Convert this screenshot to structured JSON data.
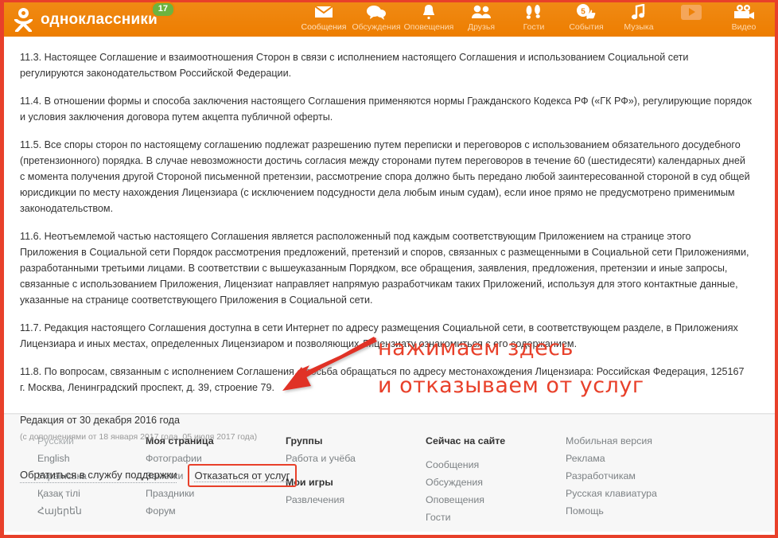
{
  "header": {
    "logo_text": "одноклассники",
    "logo_badge": "17",
    "nav": [
      {
        "label": "Сообщения",
        "icon": "envelope-icon"
      },
      {
        "label": "Обсуждения",
        "icon": "chat-bubbles-icon"
      },
      {
        "label": "Оповещения",
        "icon": "bell-icon"
      },
      {
        "label": "Друзья",
        "icon": "people-icon"
      },
      {
        "label": "Гости",
        "icon": "footprints-icon"
      },
      {
        "label": "События",
        "icon": "thumbs-up-icon",
        "badge": "5"
      },
      {
        "label": "Музыка",
        "icon": "music-note-icon"
      },
      {
        "label": "Видео",
        "icon": "video-camera-icon"
      }
    ]
  },
  "agreement": {
    "paragraphs": [
      "11.3. Настоящее Соглашение и взаимоотношения Сторон в связи с исполнением настоящего Соглашения и использованием Социальной сети регулируются законодательством Российской Федерации.",
      "11.4. В отношении формы и способа заключения настоящего Соглашения применяются нормы Гражданского Кодекса РФ («ГК РФ»), регулирующие порядок и условия заключения договора путем акцепта публичной оферты.",
      "11.5. Все споры сторон по настоящему соглашению подлежат разрешению путем переписки и переговоров с использованием обязательного досудебного (претензионного) порядка. В случае невозможности достичь согласия между сторонами путем переговоров в течение 60 (шестидесяти) календарных дней с момента получения другой Стороной письменной претензии, рассмотрение спора должно быть передано любой заинтересованной стороной в суд общей юрисдикции по месту нахождения Лицензиара (с исключением подсудности дела любым иным судам), если иное прямо не предусмотрено применимым законодательством.",
      "11.6. Неотъемлемой частью настоящего Соглашения является расположенный под каждым соответствующим Приложением на странице этого Приложения в Социальной сети Порядок рассмотрения предложений, претензий и споров, связанных с размещенными в Социальной сети Приложениями, разработанными третьими лицами. В соответствии с вышеуказанным Порядком, все обращения, заявления, предложения, претензии и иные запросы, связанные с использованием Приложения, Лицензиат направляет напрямую разработчикам таких Приложений, используя для этого контактные данные, указанные на странице соответствующего Приложения в Социальной сети.",
      "11.7. Редакция настоящего Соглашения доступна в сети Интернет по адресу размещения Социальной сети, в соответствующем разделе, в Приложениях Лицензиара и иных местах, определенных Лицензиаром и позволяющих Лицензиату ознакомиться с его содержанием.",
      "11.8. По вопросам, связанным с исполнением Соглашения, просьба обращаться по адресу местонахождения Лицензиара: Российская Федерация, 125167 г. Москва, Ленинградский проспект, д. 39, строение 79."
    ],
    "revision_title": "Редакция от 30 декабря 2016 года",
    "revision_sub": "(с дополнениями от 18 января 2017 года, 05 июля 2017 года)",
    "support_link": "Обратиться в службу поддержки",
    "cancel_link": "Отказаться от услуг"
  },
  "annotation": {
    "line1": "нажимаем здесь",
    "line2": "и отказываем от услуг",
    "color": "#e8402a"
  },
  "footer": {
    "languages": [
      "Русский",
      "English",
      "Українська",
      "Қазақ тілі",
      "Հայերեն"
    ],
    "col_my_page": {
      "head": "Моя страница",
      "links": [
        "Фотографии",
        "Заметки",
        "Праздники",
        "Форум"
      ]
    },
    "col_groups": {
      "head": "Группы",
      "links": [
        "Работа и учёба"
      ],
      "head2": "Мои игры",
      "links2": [
        "Развлечения"
      ]
    },
    "col_online": {
      "head": "Сейчас на сайте",
      "links": [
        "Сообщения",
        "Обсуждения",
        "Оповещения",
        "Гости"
      ]
    },
    "col_misc": {
      "links": [
        "Мобильная версия",
        "Реклама",
        "Разработчикам",
        "Русская клавиатура",
        "Помощь"
      ]
    }
  },
  "colors": {
    "header_orange": "#ee8208",
    "frame_red": "#e8402a",
    "badge_green": "#6cb33f",
    "footer_bg": "#f7f7f7"
  }
}
